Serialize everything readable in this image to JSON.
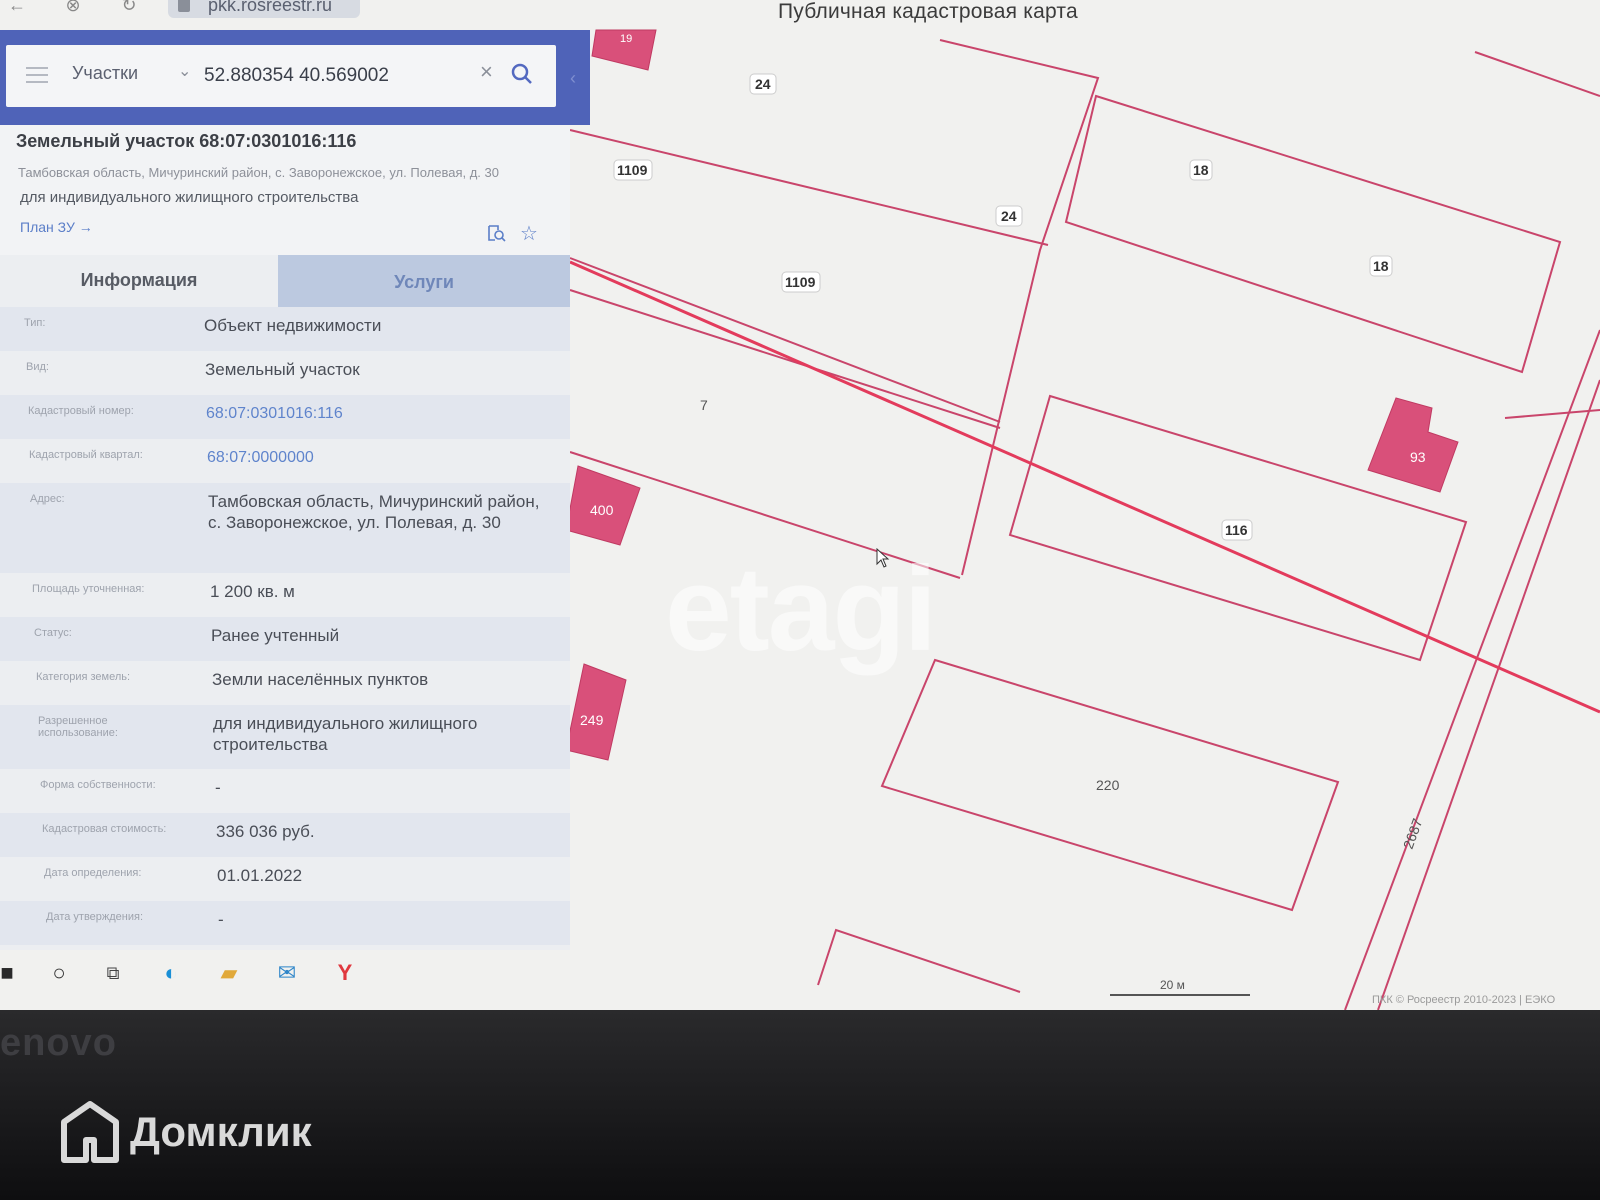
{
  "browser": {
    "url": "pkk.rosreestr.ru"
  },
  "map": {
    "title": "Публичная кадастровая карта",
    "labels": {
      "l24a": "24",
      "l1109a": "1109",
      "l24b": "24",
      "l18a": "18",
      "l18b": "18",
      "l1109b": "1109",
      "l7": "7",
      "l400": "400",
      "l93": "93",
      "l116": "116",
      "l249": "249",
      "l220": "220",
      "l2687": "2687",
      "l19": "19"
    },
    "scale_label": "20 м",
    "copyright": "ПКК © Росреестр 2010-2023 | ЕЭКО",
    "watermark": "etagi",
    "colors": {
      "parcel_line": "#c9456b",
      "building_fill": "#d9507a",
      "road_line": "#e33b5c"
    }
  },
  "search": {
    "layer": "Участки",
    "value": "52.880354 40.569002"
  },
  "panel": {
    "title": "Земельный участок 68:07:0301016:116",
    "address": "Тамбовская область, Мичуринский район, с. Заворонежское, ул. Полевая, д. 30",
    "purpose": "для индивидуального жилищного строительства",
    "plan_link": "План ЗУ →",
    "tabs": {
      "info": "Информация",
      "services": "Услуги"
    },
    "attributes": [
      {
        "k": "Тип:",
        "v": "Объект недвижимости"
      },
      {
        "k": "Вид:",
        "v": "Земельный участок"
      },
      {
        "k": "Кадастровый номер:",
        "v": "68:07:0301016:116"
      },
      {
        "k": "Кадастровый квартал:",
        "v": "68:07:0000000"
      },
      {
        "k": "Адрес:",
        "v": "Тамбовская область, Мичуринский район, с. Заворонежское, ул. Полевая, д. 30"
      },
      {
        "k": "Площадь уточненная:",
        "v": "1 200 кв. м"
      },
      {
        "k": "Статус:",
        "v": "Ранее учтенный"
      },
      {
        "k": "Категория земель:",
        "v": "Земли населённых пунктов"
      },
      {
        "k": "Разрешенное использование:",
        "v": "для индивидуального жилищного строительства"
      },
      {
        "k": "Форма собственности:",
        "v": "-"
      },
      {
        "k": "Кадастровая стоимость:",
        "v": "336 036 руб."
      },
      {
        "k": "Дата определения:",
        "v": "01.01.2022"
      },
      {
        "k": "Дата утверждения:",
        "v": "-"
      }
    ]
  },
  "bezel": {
    "monitor_brand": "enovo",
    "watermark_brand": "Домклик"
  }
}
